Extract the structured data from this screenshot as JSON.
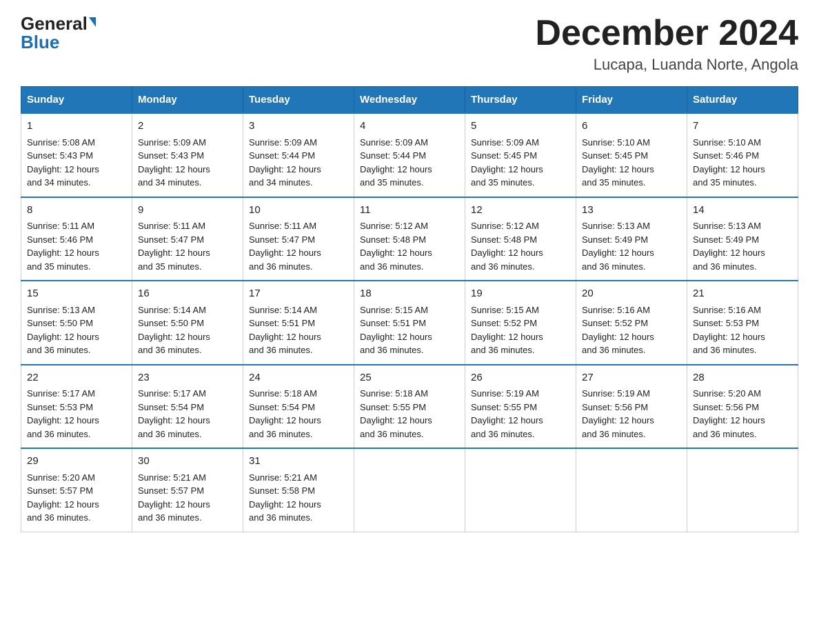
{
  "logo": {
    "top": "General",
    "bottom": "Blue"
  },
  "title": "December 2024",
  "location": "Lucapa, Luanda Norte, Angola",
  "days_of_week": [
    "Sunday",
    "Monday",
    "Tuesday",
    "Wednesday",
    "Thursday",
    "Friday",
    "Saturday"
  ],
  "weeks": [
    [
      {
        "day": "1",
        "sunrise": "5:08 AM",
        "sunset": "5:43 PM",
        "daylight": "12 hours and 34 minutes."
      },
      {
        "day": "2",
        "sunrise": "5:09 AM",
        "sunset": "5:43 PM",
        "daylight": "12 hours and 34 minutes."
      },
      {
        "day": "3",
        "sunrise": "5:09 AM",
        "sunset": "5:44 PM",
        "daylight": "12 hours and 34 minutes."
      },
      {
        "day": "4",
        "sunrise": "5:09 AM",
        "sunset": "5:44 PM",
        "daylight": "12 hours and 35 minutes."
      },
      {
        "day": "5",
        "sunrise": "5:09 AM",
        "sunset": "5:45 PM",
        "daylight": "12 hours and 35 minutes."
      },
      {
        "day": "6",
        "sunrise": "5:10 AM",
        "sunset": "5:45 PM",
        "daylight": "12 hours and 35 minutes."
      },
      {
        "day": "7",
        "sunrise": "5:10 AM",
        "sunset": "5:46 PM",
        "daylight": "12 hours and 35 minutes."
      }
    ],
    [
      {
        "day": "8",
        "sunrise": "5:11 AM",
        "sunset": "5:46 PM",
        "daylight": "12 hours and 35 minutes."
      },
      {
        "day": "9",
        "sunrise": "5:11 AM",
        "sunset": "5:47 PM",
        "daylight": "12 hours and 35 minutes."
      },
      {
        "day": "10",
        "sunrise": "5:11 AM",
        "sunset": "5:47 PM",
        "daylight": "12 hours and 36 minutes."
      },
      {
        "day": "11",
        "sunrise": "5:12 AM",
        "sunset": "5:48 PM",
        "daylight": "12 hours and 36 minutes."
      },
      {
        "day": "12",
        "sunrise": "5:12 AM",
        "sunset": "5:48 PM",
        "daylight": "12 hours and 36 minutes."
      },
      {
        "day": "13",
        "sunrise": "5:13 AM",
        "sunset": "5:49 PM",
        "daylight": "12 hours and 36 minutes."
      },
      {
        "day": "14",
        "sunrise": "5:13 AM",
        "sunset": "5:49 PM",
        "daylight": "12 hours and 36 minutes."
      }
    ],
    [
      {
        "day": "15",
        "sunrise": "5:13 AM",
        "sunset": "5:50 PM",
        "daylight": "12 hours and 36 minutes."
      },
      {
        "day": "16",
        "sunrise": "5:14 AM",
        "sunset": "5:50 PM",
        "daylight": "12 hours and 36 minutes."
      },
      {
        "day": "17",
        "sunrise": "5:14 AM",
        "sunset": "5:51 PM",
        "daylight": "12 hours and 36 minutes."
      },
      {
        "day": "18",
        "sunrise": "5:15 AM",
        "sunset": "5:51 PM",
        "daylight": "12 hours and 36 minutes."
      },
      {
        "day": "19",
        "sunrise": "5:15 AM",
        "sunset": "5:52 PM",
        "daylight": "12 hours and 36 minutes."
      },
      {
        "day": "20",
        "sunrise": "5:16 AM",
        "sunset": "5:52 PM",
        "daylight": "12 hours and 36 minutes."
      },
      {
        "day": "21",
        "sunrise": "5:16 AM",
        "sunset": "5:53 PM",
        "daylight": "12 hours and 36 minutes."
      }
    ],
    [
      {
        "day": "22",
        "sunrise": "5:17 AM",
        "sunset": "5:53 PM",
        "daylight": "12 hours and 36 minutes."
      },
      {
        "day": "23",
        "sunrise": "5:17 AM",
        "sunset": "5:54 PM",
        "daylight": "12 hours and 36 minutes."
      },
      {
        "day": "24",
        "sunrise": "5:18 AM",
        "sunset": "5:54 PM",
        "daylight": "12 hours and 36 minutes."
      },
      {
        "day": "25",
        "sunrise": "5:18 AM",
        "sunset": "5:55 PM",
        "daylight": "12 hours and 36 minutes."
      },
      {
        "day": "26",
        "sunrise": "5:19 AM",
        "sunset": "5:55 PM",
        "daylight": "12 hours and 36 minutes."
      },
      {
        "day": "27",
        "sunrise": "5:19 AM",
        "sunset": "5:56 PM",
        "daylight": "12 hours and 36 minutes."
      },
      {
        "day": "28",
        "sunrise": "5:20 AM",
        "sunset": "5:56 PM",
        "daylight": "12 hours and 36 minutes."
      }
    ],
    [
      {
        "day": "29",
        "sunrise": "5:20 AM",
        "sunset": "5:57 PM",
        "daylight": "12 hours and 36 minutes."
      },
      {
        "day": "30",
        "sunrise": "5:21 AM",
        "sunset": "5:57 PM",
        "daylight": "12 hours and 36 minutes."
      },
      {
        "day": "31",
        "sunrise": "5:21 AM",
        "sunset": "5:58 PM",
        "daylight": "12 hours and 36 minutes."
      },
      null,
      null,
      null,
      null
    ]
  ],
  "labels": {
    "sunrise": "Sunrise:",
    "sunset": "Sunset:",
    "daylight": "Daylight:"
  }
}
